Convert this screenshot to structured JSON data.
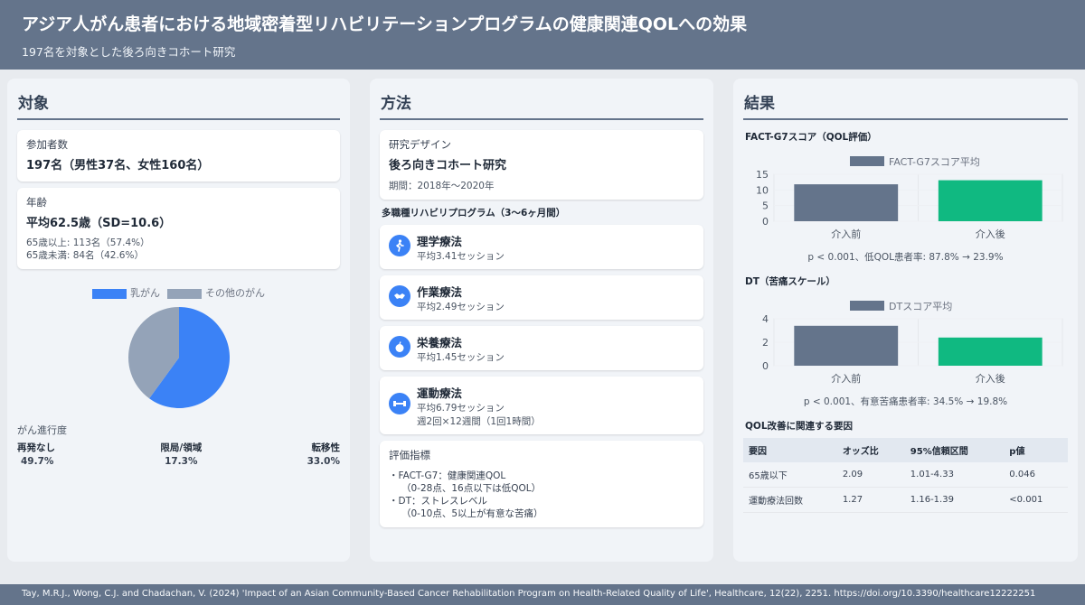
{
  "header": {
    "title": "アジア人がん患者における地域密着型リハビリテーションプログラムの健康関連QOLへの効果",
    "subtitle": "197名を対象とした後ろ向きコホート研究"
  },
  "subjects": {
    "heading": "対象",
    "participants_label": "参加者数",
    "participants_value": "197名（男性37名、女性160名）",
    "age_label": "年齢",
    "age_value": "平均62.5歳（SD=10.6）",
    "age_over": "65歳以上: 113名（57.4%）",
    "age_under": "65歳未満: 84名（42.6%）",
    "stage_title": "がん進行度",
    "stages": [
      {
        "name": "再発なし",
        "value": "49.7%"
      },
      {
        "name": "限局/領域",
        "value": "17.3%"
      },
      {
        "name": "転移性",
        "value": "33.0%"
      }
    ]
  },
  "methods": {
    "heading": "方法",
    "design_label": "研究デザイン",
    "design_value": "後ろ向きコホート研究",
    "period": "期間：2018年〜2020年",
    "program_title": "多職種リハビリプログラム（3〜6ヶ月間）",
    "programs": [
      {
        "name": "理学療法",
        "line1": "平均3.41セッション",
        "line2": "",
        "icon": "walking-icon"
      },
      {
        "name": "作業療法",
        "line1": "平均2.49セッション",
        "line2": "",
        "icon": "handshake-icon"
      },
      {
        "name": "栄養療法",
        "line1": "平均1.45セッション",
        "line2": "",
        "icon": "apple-icon"
      },
      {
        "name": "運動療法",
        "line1": "平均6.79セッション",
        "line2": "週2回×12週間（1回1時間）",
        "icon": "dumbbell-icon"
      }
    ],
    "eval_label": "評価指標",
    "eval_1": "・FACT-G7：健康関連QOL",
    "eval_1_note": "（0-28点、16点以下は低QOL）",
    "eval_2": "・DT：ストレスレベル",
    "eval_2_note": "（0-10点、5以上が有意な苦痛）"
  },
  "results": {
    "heading": "結果",
    "fact_title": "FACT-G7スコア（QOL評価）",
    "fact_note": "p < 0.001、低QOL患者率: 87.8% → 23.9%",
    "dt_title": "DT（苦痛スケール）",
    "dt_note": "p < 0.001、有意苦痛患者率: 34.5% → 19.8%",
    "table_title": "QOL改善に関連する要因",
    "table_headers": [
      "要因",
      "オッズ比",
      "95%信頼区間",
      "p値"
    ],
    "table_rows": [
      [
        "65歳以下",
        "2.09",
        "1.01-4.33",
        "0.046"
      ],
      [
        "運動療法回数",
        "1.27",
        "1.16-1.39",
        "<0.001"
      ]
    ]
  },
  "chart_data": [
    {
      "type": "pie",
      "legend": [
        "乳がん",
        "その他のがん"
      ],
      "values": [
        60,
        40
      ],
      "colors": [
        "#3b82f6",
        "#94a3b8"
      ]
    },
    {
      "type": "bar",
      "legend": [
        "FACT-G7スコア平均"
      ],
      "categories": [
        "介入前",
        "介入後"
      ],
      "values": [
        11.8,
        13.1
      ],
      "bar_colors": [
        "#64748b",
        "#10b981"
      ],
      "yticks": [
        0,
        5,
        10,
        15
      ],
      "ylim": [
        0,
        15
      ]
    },
    {
      "type": "bar",
      "legend": [
        "DTスコア平均"
      ],
      "categories": [
        "介入前",
        "介入後"
      ],
      "values": [
        3.4,
        2.4
      ],
      "bar_colors": [
        "#64748b",
        "#10b981"
      ],
      "yticks": [
        0,
        2,
        4
      ],
      "ylim": [
        0,
        4
      ]
    }
  ],
  "footer": "Tay, M.R.J., Wong, C.J. and Chadachan, V. (2024) 'Impact of an Asian Community-Based Cancer Rehabilitation Program on Health-Related Quality of Life', Healthcare, 12(22), 2251. https://doi.org/10.3390/healthcare12222251"
}
